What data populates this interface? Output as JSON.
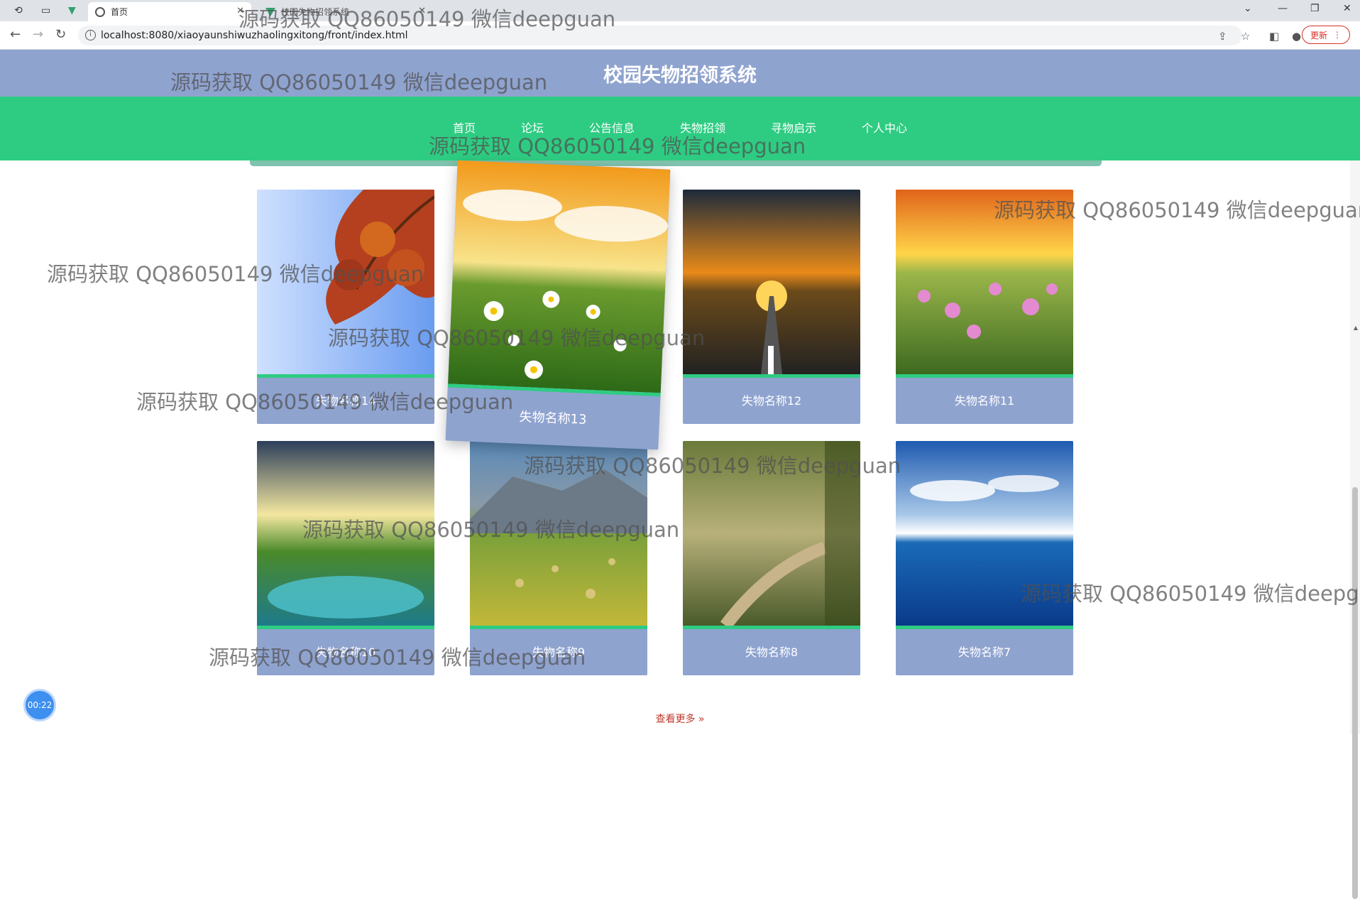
{
  "browser": {
    "tabs": [
      {
        "label": "首页",
        "active": true
      },
      {
        "label": "校园失物招领系统",
        "active": false
      }
    ],
    "url": "localhost:8080/xiaoyaunshiwuzhaolingxitong/front/index.html",
    "update_label": "更新"
  },
  "site": {
    "title": "校园失物招领系统"
  },
  "nav": {
    "items": [
      {
        "label": "首页",
        "active": true
      },
      {
        "label": "论坛"
      },
      {
        "label": "公告信息"
      },
      {
        "label": "失物招领"
      },
      {
        "label": "寻物启示"
      },
      {
        "label": "个人中心"
      }
    ]
  },
  "items": [
    {
      "name": "失物名称14",
      "image": "autumn-leaves"
    },
    {
      "name": "失物名称13",
      "image": "daisy-field"
    },
    {
      "name": "失物名称12",
      "image": "sunset-road"
    },
    {
      "name": "失物名称11",
      "image": "flower-meadow"
    },
    {
      "name": "失物名称10",
      "image": "mountain-lake"
    },
    {
      "name": "失物名称9",
      "image": "hay-field"
    },
    {
      "name": "失物名称8",
      "image": "forest-path"
    },
    {
      "name": "失物名称7",
      "image": "blue-lake"
    }
  ],
  "more_label": "查看更多 »",
  "timer": "00:22",
  "watermark": "源码获取 QQ86050149 微信deepguan",
  "colors": {
    "header": "#8fa3cf",
    "menu": "#2ecc82",
    "more": "#c0392b"
  }
}
